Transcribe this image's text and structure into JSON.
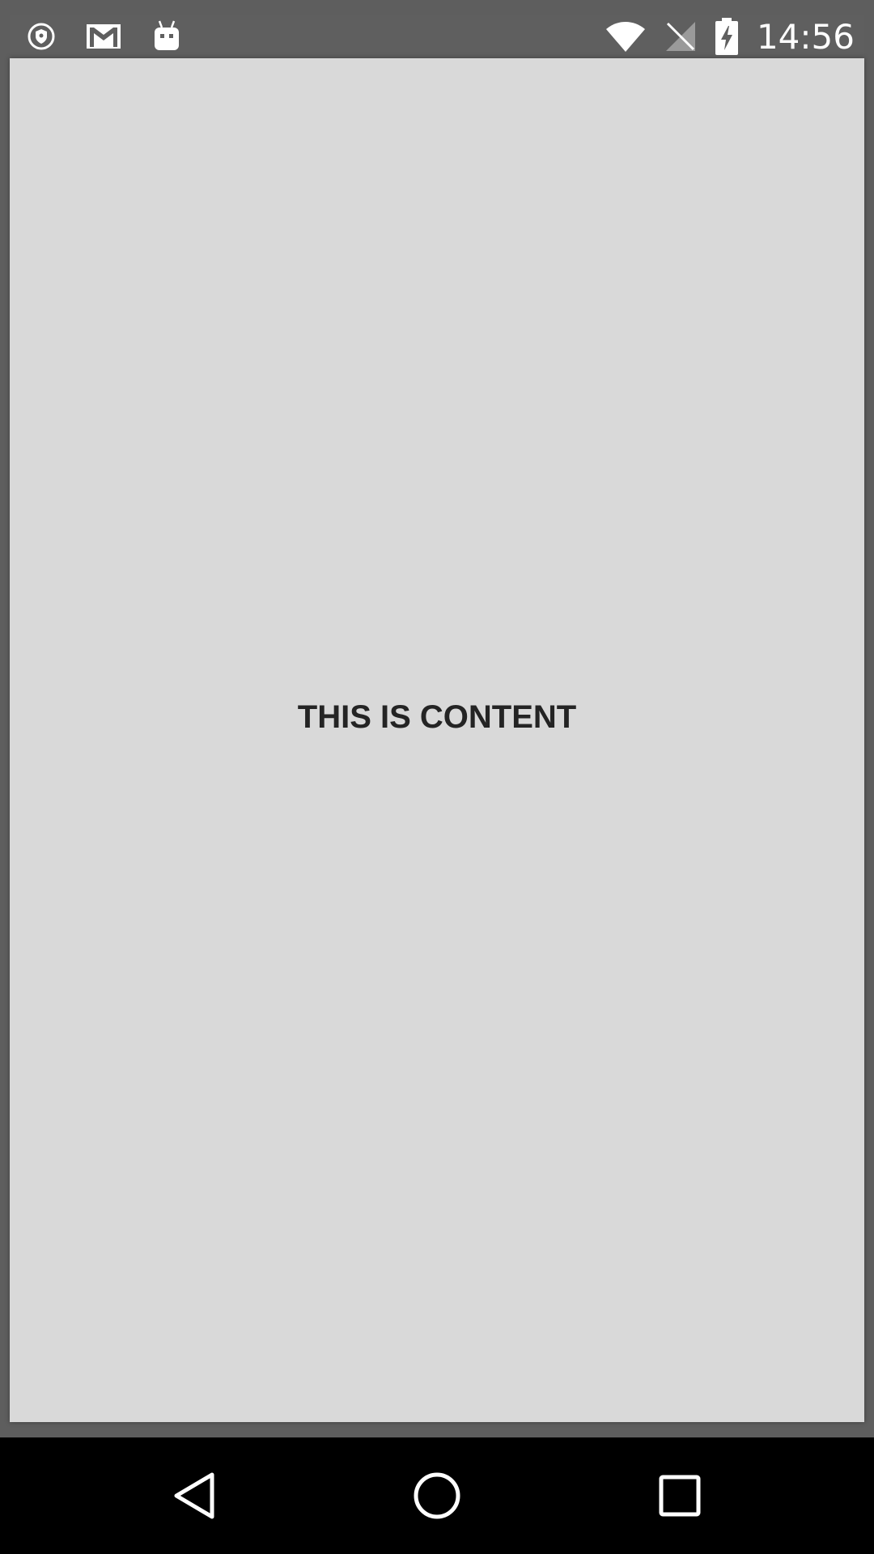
{
  "status_bar": {
    "time": "14:56",
    "left_icons": [
      "shield-notification-icon",
      "gmail-icon",
      "android-debug-icon"
    ],
    "right_icons": [
      "wifi-icon",
      "no-signal-icon",
      "battery-charging-icon"
    ]
  },
  "content": {
    "text": "THIS IS CONTENT"
  },
  "navigation": {
    "buttons": [
      "back-icon",
      "home-icon",
      "recents-icon"
    ]
  },
  "colors": {
    "content_background": "#d9d9d9",
    "status_bar": "#5f5f5f",
    "nav_bar": "#000000",
    "text": "#242424"
  }
}
